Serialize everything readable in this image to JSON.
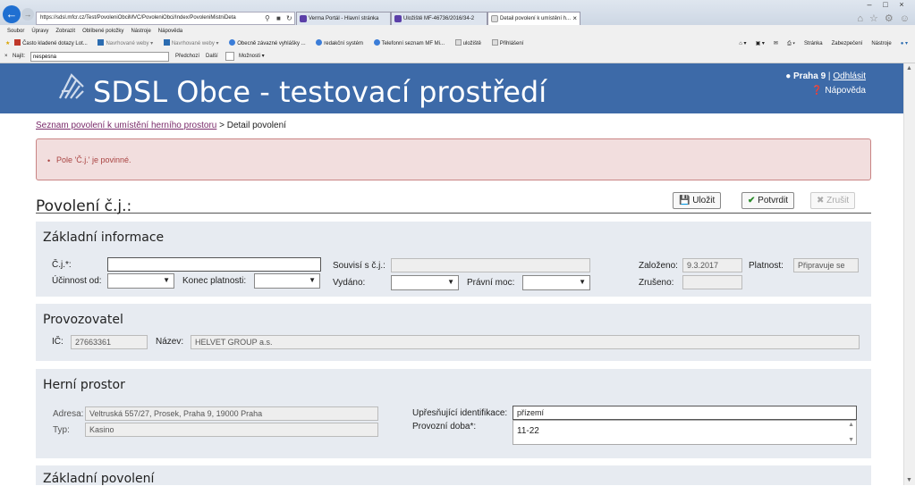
{
  "browser": {
    "address": "https://sdsl.mfcr.cz/Test/PovoleniObciMVC/PovoleniObci/Index/PovoleniMistniDeta",
    "tabs": [
      "Verma Portál - Hlavní stránka",
      "Uložiště MF-46736/2016/34-2",
      "Detail povolení k umístění h..."
    ],
    "menu": [
      "Soubor",
      "Úpravy",
      "Zobrazit",
      "Oblíbené položky",
      "Nástroje",
      "Nápověda"
    ],
    "favorites": [
      "Často kladené dotazy Lot...",
      "Navrhované weby",
      "Navrhované weby",
      "Obecně závazné vyhlášky ...",
      "redakční systém",
      "Telefonní seznam MF Mi...",
      "uložiště",
      "Přihlášení"
    ],
    "commands": [
      "Stránka",
      "Zabezpečení",
      "Nástroje"
    ],
    "find": {
      "label": "Najít:",
      "value": "nespěšná",
      "prev": "Předchozí",
      "next": "Další",
      "options": "Možnosti"
    }
  },
  "header": {
    "title": "SDSL Obce - testovací prostředí",
    "user": "Praha 9",
    "logout": "Odhlásit",
    "help": "Nápověda"
  },
  "breadcrumb": {
    "link": "Seznam povolení k umístění herního prostoru",
    "sep": ">",
    "current": "Detail povolení"
  },
  "alert": {
    "message": "Pole 'Č.j.' je povinné."
  },
  "page": {
    "title": "Povolení č.j.:",
    "save": "Uložit",
    "confirm": "Potvrdit",
    "cancel": "Zrušit"
  },
  "basic": {
    "title": "Základní informace",
    "cj_label": "Č.j.*:",
    "cj_value": "",
    "ucinnost_label": "Účinnost od:",
    "konec_label": "Konec platnosti:",
    "souvisi_label": "Souvisí s č.j.:",
    "souvisi_value": "",
    "vydano_label": "Vydáno:",
    "pravni_label": "Právní moc:",
    "zalozeno_label": "Založeno:",
    "zalozeno_value": "9.3.2017",
    "platnost_label": "Platnost:",
    "platnost_value": "Připravuje se",
    "zruseno_label": "Zrušeno:",
    "zruseno_value": ""
  },
  "operator": {
    "title": "Provozovatel",
    "ic_label": "IČ:",
    "ic_value": "27663361",
    "nazev_label": "Název:",
    "nazev_value": "HELVET GROUP a.s."
  },
  "venue": {
    "title": "Herní prostor",
    "adresa_label": "Adresa:",
    "adresa_value": "Veltruská 557/27, Prosek, Praha 9, 19000 Praha",
    "typ_label": "Typ:",
    "typ_value": "Kasino",
    "upres_label": "Upřesňující identifikace:",
    "upres_value": "přízemí",
    "doba_label": "Provozní doba*:",
    "doba_value": "11-22"
  },
  "next_section": {
    "title": "Základní povolení"
  }
}
